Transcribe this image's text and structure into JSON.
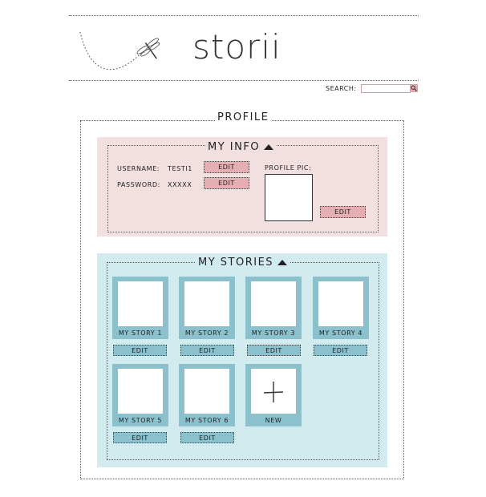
{
  "header": {
    "logo_text": "storii"
  },
  "search": {
    "label": "SEARCH:",
    "value": "",
    "placeholder": ""
  },
  "profile": {
    "title": "PROFILE",
    "my_info": {
      "title": "MY INFO",
      "username_label": "USERNAME:",
      "username_value": "TESTI1",
      "password_label": "PASSWORD:",
      "password_value": "XXXXX",
      "profile_pic_label": "PROFILE PIC:",
      "edit_label": "EDIT"
    },
    "my_stories": {
      "title": "MY STORIES",
      "edit_label": "EDIT",
      "new_label": "NEW",
      "stories": [
        {
          "title": "MY STORY 1"
        },
        {
          "title": "MY STORY 2"
        },
        {
          "title": "MY STORY 3"
        },
        {
          "title": "MY STORY 4"
        },
        {
          "title": "MY STORY 5"
        },
        {
          "title": "MY STORY 6"
        }
      ]
    }
  },
  "colors": {
    "info_bg": "#f2dfe0",
    "pink_button": "#e4aeb3",
    "stories_bg": "#d2ebee",
    "card_blue": "#8bc1cc"
  },
  "icons": {
    "logo": "dragonfly-icon",
    "search": "magnifier-icon",
    "collapse": "triangle-up-icon",
    "new": "plus-icon"
  }
}
